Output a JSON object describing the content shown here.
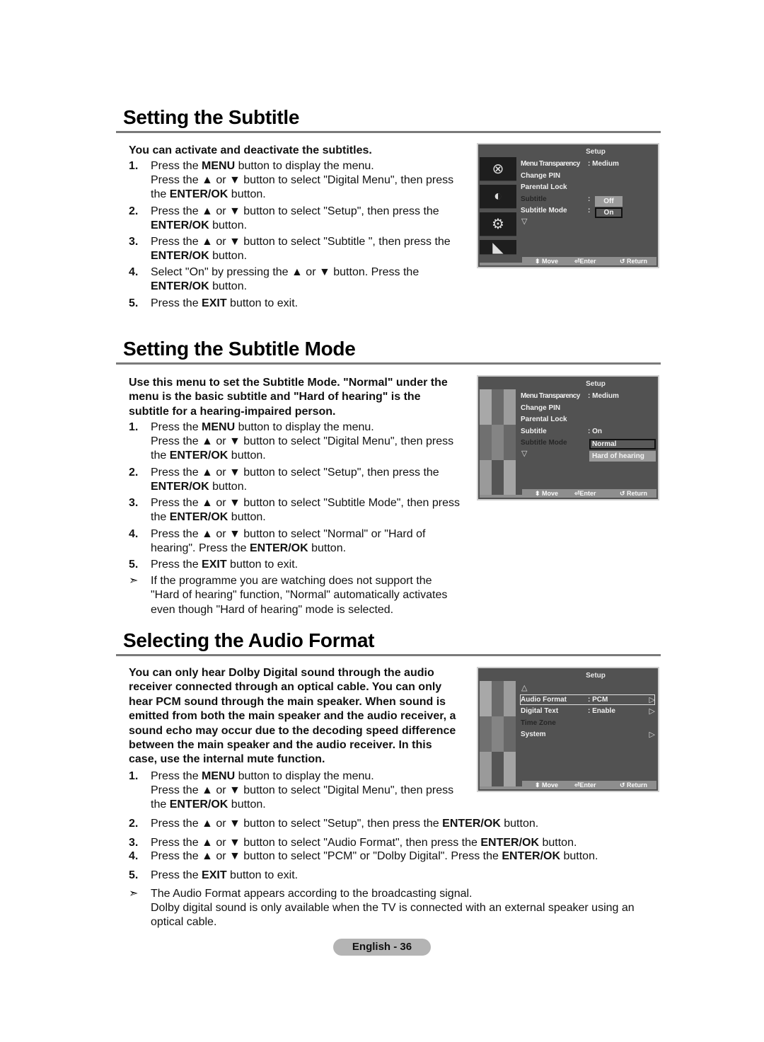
{
  "sections": [
    {
      "title": "Setting the Subtitle",
      "lead": "You can activate and deactivate the subtitles.",
      "steps": [
        {
          "num": "1.",
          "parts": [
            [
              "Press the ",
              ""
            ],
            [
              "MENU",
              "b"
            ],
            [
              " button to display the menu.",
              ""
            ]
          ]
        },
        {
          "num": "",
          "parts": [
            [
              "Press the ▲ or ▼ button to select \"Digital Menu\", then press the ",
              ""
            ],
            [
              "ENTER/OK",
              "b"
            ],
            [
              " button.",
              ""
            ]
          ]
        },
        {
          "num": "2.",
          "parts": [
            [
              "Press the ▲ or ▼ button to select \"Setup\", then press the ",
              ""
            ],
            [
              "ENTER/OK",
              "b"
            ],
            [
              " button.",
              ""
            ]
          ]
        },
        {
          "num": "3.",
          "parts": [
            [
              "Press the ▲ or ▼ button to select \"Subtitle \", then press the ",
              ""
            ],
            [
              "ENTER/OK",
              "b"
            ],
            [
              " button.",
              ""
            ]
          ]
        },
        {
          "num": "4.",
          "parts": [
            [
              "Select \"On\" by pressing the ▲ or ▼ button. Press the ",
              ""
            ],
            [
              "ENTER/OK",
              "b"
            ],
            [
              " button.",
              ""
            ]
          ]
        },
        {
          "num": "5.",
          "parts": [
            [
              "Press the ",
              ""
            ],
            [
              "EXIT",
              "b"
            ],
            [
              " button to exit.",
              ""
            ]
          ]
        }
      ]
    },
    {
      "title": "Setting the Subtitle Mode",
      "lead": "Use this menu to set the Subtitle Mode. \"Normal\" under the menu is the basic subtitle and \"Hard of hearing\" is the subtitle for a hearing-impaired person.",
      "steps": [
        {
          "num": "1.",
          "parts": [
            [
              "Press the ",
              ""
            ],
            [
              "MENU",
              "b"
            ],
            [
              " button to display the menu.",
              ""
            ]
          ]
        },
        {
          "num": "",
          "parts": [
            [
              "Press the ▲ or ▼ button to select \"Digital Menu\", then press the ",
              ""
            ],
            [
              "ENTER/OK",
              "b"
            ],
            [
              " button.",
              ""
            ]
          ]
        },
        {
          "num": "2.",
          "parts": [
            [
              "Press the ▲ or ▼ button to select \"Setup\", then press the ",
              ""
            ],
            [
              "ENTER/OK",
              "b"
            ],
            [
              " button.",
              ""
            ]
          ]
        },
        {
          "num": "3.",
          "parts": [
            [
              "Press the ▲ or ▼ button to select \"Subtitle  Mode\", then press the ",
              ""
            ],
            [
              "ENTER/OK",
              "b"
            ],
            [
              " button.",
              ""
            ]
          ]
        },
        {
          "num": "4.",
          "parts": [
            [
              "Press the ▲ or ▼ button to select \"Normal\" or \"Hard of hearing\". Press the ",
              ""
            ],
            [
              "ENTER/OK",
              "b"
            ],
            [
              " button.",
              ""
            ]
          ]
        },
        {
          "num": "5.",
          "parts": [
            [
              "Press the ",
              ""
            ],
            [
              "EXIT",
              "b"
            ],
            [
              " button to exit.",
              ""
            ]
          ]
        },
        {
          "num": "➣",
          "parts": [
            [
              "If the programme you are watching does not support the \"Hard of hearing\" function, \"Normal\" automatically activates even though \"Hard of hearing\" mode is selected.",
              ""
            ]
          ]
        }
      ]
    },
    {
      "title": "Selecting the Audio Format",
      "lead": "You can only hear Dolby Digital sound through the audio receiver connected through an optical cable. You can only hear PCM sound through the main speaker. When sound is emitted from both the main speaker and the audio receiver, a sound echo may occur due to the decoding speed difference between the main speaker and the audio receiver. In this case, use the internal mute function.",
      "steps": [
        {
          "num": "1.",
          "parts": [
            [
              "Press the ",
              ""
            ],
            [
              "MENU",
              "b"
            ],
            [
              " button to display the menu.",
              ""
            ]
          ]
        },
        {
          "num": "",
          "parts": [
            [
              "Press the ▲ or ▼ button to select \"Digital Menu\", then press the ",
              ""
            ],
            [
              "ENTER/OK",
              "b"
            ],
            [
              " button.",
              ""
            ]
          ]
        },
        {
          "num": "2.",
          "parts": [
            [
              "Press the ▲ or ▼ button to select \"Setup\", then press the ",
              ""
            ],
            [
              "ENTER/OK",
              "b"
            ],
            [
              " button.",
              ""
            ]
          ]
        },
        {
          "num": "3.",
          "parts": [
            [
              "Press the ▲ or ▼ button to select \"Audio Format\", then press the ",
              ""
            ],
            [
              "ENTER/OK",
              "b"
            ],
            [
              " button.",
              ""
            ]
          ]
        },
        {
          "num": "4.",
          "parts": [
            [
              "Press the ▲ or ▼ button to select \"PCM\" or \"Dolby Digital\". Press the ",
              ""
            ],
            [
              "ENTER/OK",
              "b"
            ],
            [
              " button.",
              ""
            ]
          ]
        },
        {
          "num": "5.",
          "parts": [
            [
              "Press the ",
              ""
            ],
            [
              "EXIT",
              "b"
            ],
            [
              " button to exit.",
              ""
            ]
          ]
        },
        {
          "num": "➣",
          "parts": [
            [
              "The Audio Format appears according to the broadcasting signal.",
              ""
            ]
          ]
        },
        {
          "num": "",
          "parts": [
            [
              "Dolby digital sound is only available when the TV is connected with an external speaker using an optical cable.",
              ""
            ]
          ]
        }
      ]
    }
  ],
  "osd1": {
    "title": "Setup",
    "rows": [
      {
        "label": "Menu Transparency",
        "value": ": Medium"
      },
      {
        "label": "Change PIN",
        "value": ""
      },
      {
        "label": "Parental Lock",
        "value": ""
      },
      {
        "label": "Subtitle",
        "value": ":"
      },
      {
        "label": "Subtitle  Mode",
        "value": ":"
      }
    ],
    "options": [
      "Off",
      "On"
    ],
    "scroll_down": "▽",
    "side_icons": [
      "antenna-icon",
      "satellite-dish-icon",
      "gear-icon",
      "input-plug-icon"
    ],
    "footer": {
      "move": "⬍ Move",
      "enter": "⏎Enter",
      "return": "↺ Return"
    }
  },
  "osd2": {
    "title": "Setup",
    "rows": [
      {
        "label": "Menu Transparency",
        "value": ": Medium"
      },
      {
        "label": "Change PIN",
        "value": ""
      },
      {
        "label": "Parental Lock",
        "value": ""
      },
      {
        "label": "Subtitle",
        "value": ": On"
      },
      {
        "label": "Subtitle  Mode",
        "value": ""
      }
    ],
    "options": [
      "Normal",
      "Hard of hearing"
    ],
    "scroll_down": "▽",
    "footer": {
      "move": "⬍ Move",
      "enter": "⏎Enter",
      "return": "↺ Return"
    }
  },
  "osd3": {
    "title": "Setup",
    "scroll_up": "△",
    "rows": [
      {
        "label": "Audio Format",
        "value": ": PCM",
        "arrow": "▷"
      },
      {
        "label": "Digital Text",
        "value": ": Enable",
        "arrow": "▷"
      },
      {
        "label": "Time Zone",
        "value": "",
        "arrow": ""
      },
      {
        "label": "System",
        "value": "",
        "arrow": "▷"
      }
    ],
    "footer": {
      "move": "⬍ Move",
      "enter": "⏎Enter",
      "return": "↺ Return"
    }
  },
  "footer": {
    "page_label": "English - 36"
  }
}
